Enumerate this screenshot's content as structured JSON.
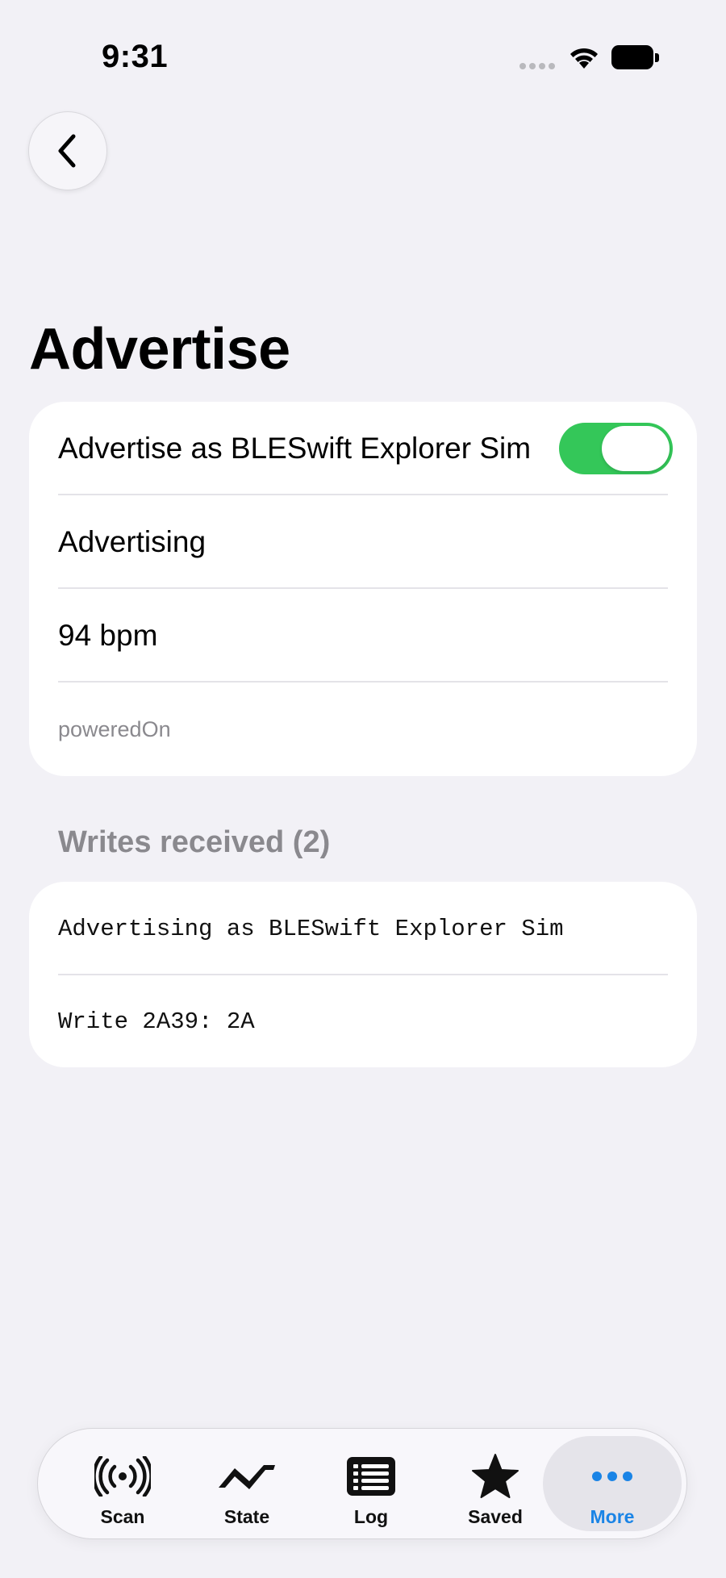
{
  "status_bar": {
    "time": "9:31"
  },
  "nav": {
    "back_icon": "chevron-left-icon"
  },
  "page": {
    "title": "Advertise"
  },
  "advertise_card": {
    "toggle_label": "Advertise as BLESwift Explorer Sim",
    "toggle_on": true,
    "status": "Advertising",
    "heart_rate": "94 bpm",
    "bluetooth_state": "poweredOn"
  },
  "writes_section": {
    "header": "Writes received (2)",
    "items": [
      "Advertising as BLESwift Explorer Sim",
      "Write 2A39: 2A"
    ]
  },
  "tab_bar": {
    "tabs": [
      {
        "label": "Scan",
        "icon": "broadcast-icon"
      },
      {
        "label": "State",
        "icon": "waveform-icon"
      },
      {
        "label": "Log",
        "icon": "list-icon"
      },
      {
        "label": "Saved",
        "icon": "star-icon"
      },
      {
        "label": "More",
        "icon": "ellipsis-icon",
        "active": true
      }
    ],
    "active_color": "#1a84e6"
  },
  "colors": {
    "toggle_on": "#34c759",
    "background": "#f2f1f6"
  }
}
